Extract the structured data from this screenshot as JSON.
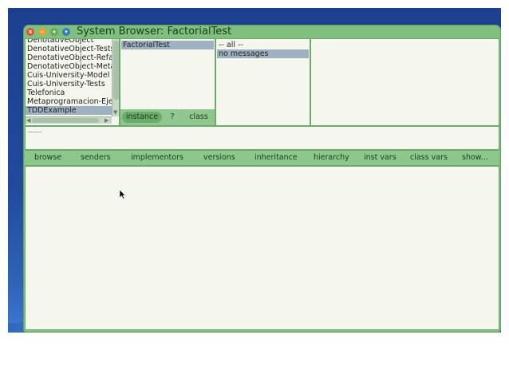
{
  "window": {
    "title": "System Browser: FactorialTest"
  },
  "colors": {
    "window_frame": "#7fc07f",
    "pane_background": "#f5f7ee",
    "selection": "#9fb1c0",
    "close": "#e0503c",
    "minimize": "#e8a030",
    "expand": "#6aa84f",
    "menu": "#3a78c8"
  },
  "title_buttons": [
    {
      "name": "close-icon",
      "glyph": "×"
    },
    {
      "name": "minimize-icon",
      "glyph": "–"
    },
    {
      "name": "expand-icon",
      "glyph": "+"
    },
    {
      "name": "menu-icon",
      "glyph": "▾"
    }
  ],
  "categories": {
    "items": [
      "DenotativeObject",
      "DenotativeObject-Tests",
      "DenotativeObject-Refac",
      "DenotativeObject-Meta",
      "Cuis-University-Model",
      "Cuis-University-Tests",
      "Telefonica",
      "Metaprogramacion-Ejem",
      "TDDExample"
    ],
    "selected": "TDDExample"
  },
  "classes": {
    "items": [
      "FactorialTest"
    ],
    "selected": "FactorialTest"
  },
  "class_mode": {
    "instance_label": "instance",
    "help_label": "?",
    "class_label": "class",
    "active": "instance"
  },
  "protocols": {
    "items": [
      "-- all --",
      "no messages"
    ],
    "selected": "no messages"
  },
  "messages": {
    "items": []
  },
  "annotation": {
    "text": "------"
  },
  "toolbar": {
    "buttons": [
      "browse",
      "senders",
      "implementors",
      "versions",
      "inheritance",
      "hierarchy",
      "inst vars",
      "class vars",
      "show..."
    ]
  },
  "code": {
    "text": ""
  }
}
